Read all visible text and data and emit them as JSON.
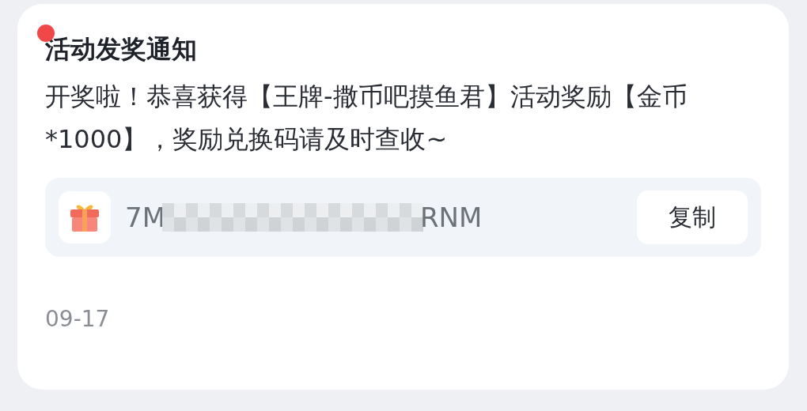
{
  "notice": {
    "unread": true,
    "title": "活动发奖通知",
    "message": "开奖啦！恭喜获得【王牌-撒币吧摸鱼君】活动奖励【金币*1000】，奖励兑换码请及时查收~",
    "code": {
      "start": "7M",
      "end": "RNM",
      "blurred": true
    },
    "copy_button": "复制",
    "date": "09-17"
  }
}
